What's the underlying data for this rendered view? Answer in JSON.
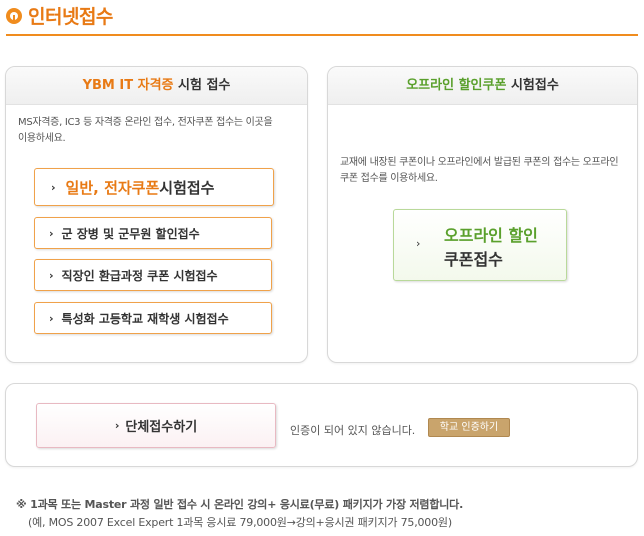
{
  "header": {
    "title": "인터넷접수"
  },
  "ybm_panel": {
    "title_part1": "YBM IT 자격증",
    "title_part2": " 시험 접수",
    "description": "MS자격증, IC3 등 자격증 온라인 접수, 전자쿠폰 접수는 이곳을 이용하세요.",
    "main_button_part1": "일반, 전자쿠폰",
    "main_button_part2": " 시험접수",
    "buttons": [
      "군 장병 및 군무원 할인접수",
      "직장인 환급과정 쿠폰 시험접수",
      "특성화 고등학교 재학생 시험접수"
    ]
  },
  "offline_panel": {
    "title_part1": "오프라인 할인쿠폰",
    "title_part2": " 시험접수",
    "description": "교재에 내장된 쿠폰이나 오프라인에서 발급된 쿠폰의 접수는 오프라인 쿠폰 접수를 이용하세요.",
    "button_line1": "오프라인 할인",
    "button_line2": "쿠폰접수"
  },
  "group_panel": {
    "button_label": "단체접수하기",
    "auth_status": "인증이 되어 있지 않습니다.",
    "auth_button": "학교 인증하기"
  },
  "notes": {
    "line1": "※ 1과목 또는 Master 과정 일반 접수 시 온라인 강의+ 응시료(무료) 패키지가 가장 저렴합니다.",
    "line2": "(예, MOS 2007 Excel Expert 1과목 응시료 79,000원→강의+응시권 패키지가 75,000원)"
  },
  "icons": {
    "chevron": "›",
    "header_bullet": "circle-bullet-icon"
  },
  "colors": {
    "accent_orange": "#e87a15",
    "accent_green": "#5aa02c",
    "auth_button": "#c9a46c"
  }
}
